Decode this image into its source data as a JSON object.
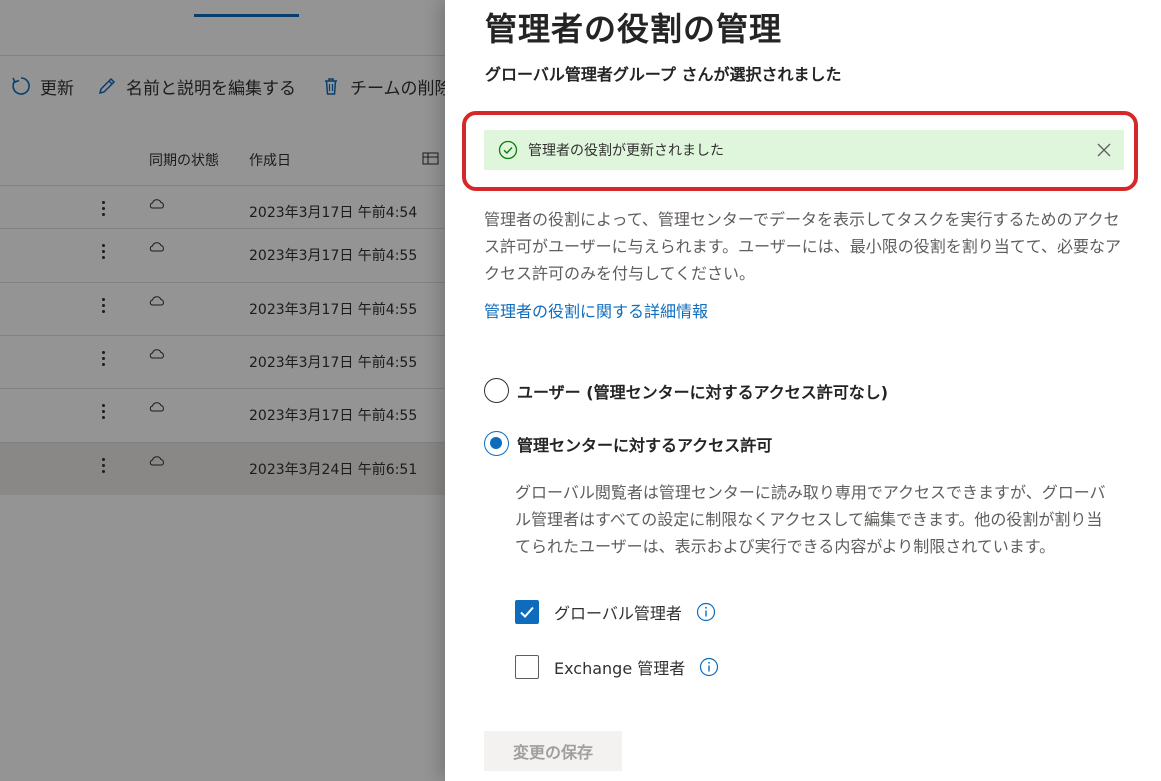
{
  "commandbar": {
    "refresh_label": "更新",
    "edit_label": "名前と説明を編集する",
    "delete_label": "チームの削除"
  },
  "grid": {
    "columns": {
      "sync_status": "同期の状態",
      "created": "作成日"
    },
    "rows": [
      {
        "created": "2023年3月17日 午前4:54"
      },
      {
        "created": "2023年3月17日 午前4:55"
      },
      {
        "created": "2023年3月17日 午前4:55"
      },
      {
        "created": "2023年3月17日 午前4:55"
      },
      {
        "created": "2023年3月17日 午前4:55"
      },
      {
        "created": "2023年3月24日 午前6:51"
      }
    ]
  },
  "panel": {
    "title": "管理者の役割の管理",
    "subtitle": "グローバル管理者グループ さんが選択されました",
    "message": "管理者の役割が更新されました",
    "description": "管理者の役割によって、管理センターでデータを表示してタスクを実行するためのアクセス許可がユーザーに与えられます。ユーザーには、最小限の役割を割り当てて、必要なアクセス許可のみを付与してください。",
    "learn_more": "管理者の役割に関する詳細情報",
    "radio_user": "ユーザー (管理センターに対するアクセス許可なし)",
    "radio_admin": "管理センターに対するアクセス許可",
    "admin_description": "グローバル閲覧者は管理センターに読み取り専用でアクセスできますが、グローバル管理者はすべての設定に制限なくアクセスして編集できます。他の役割が割り当てられたユーザーは、表示および実行できる内容がより制限されています。",
    "checkbox_global": "グローバル管理者",
    "checkbox_exchange": "Exchange 管理者",
    "save_label": "変更の保存"
  },
  "state": {
    "selected_radio": "admin",
    "global_admin_checked": true,
    "exchange_admin_checked": false,
    "save_enabled": false
  },
  "colors": {
    "accent": "#0f6cbd",
    "success_bg": "#dff6dd",
    "success_icon": "#107c10",
    "highlight": "#d62828"
  },
  "icons": {
    "refresh": "refresh-icon",
    "edit": "pencil-icon",
    "delete": "trash-icon",
    "success": "check-circle-icon",
    "close": "close-icon",
    "info": "info-icon",
    "cloud": "cloud-icon"
  }
}
